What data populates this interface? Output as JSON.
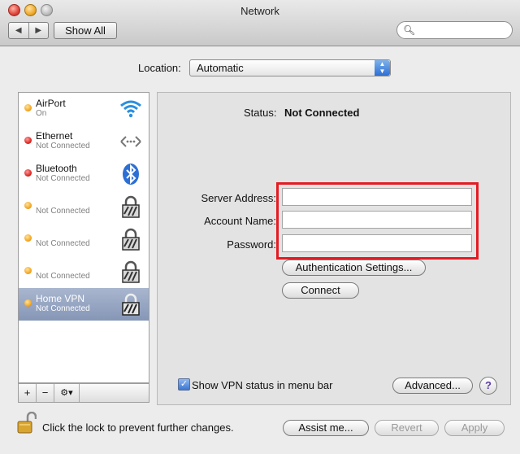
{
  "window": {
    "title": "Network"
  },
  "toolbar": {
    "back": "◀",
    "forward": "▶",
    "show_all": "Show All",
    "search_placeholder": ""
  },
  "location": {
    "label": "Location:",
    "value": "Automatic"
  },
  "sidebar": {
    "items": [
      {
        "name": "AirPort",
        "status": "On",
        "dot": "orange",
        "icon": "wifi-icon"
      },
      {
        "name": "Ethernet",
        "status": "Not Connected",
        "dot": "red",
        "icon": "ethernet-icon"
      },
      {
        "name": "Bluetooth",
        "status": "Not Connected",
        "dot": "red",
        "icon": "bluetooth-icon"
      },
      {
        "name": "",
        "status": "Not Connected",
        "dot": "orange",
        "icon": "vpn-lock-icon"
      },
      {
        "name": "",
        "status": "Not Connected",
        "dot": "orange",
        "icon": "vpn-lock-icon"
      },
      {
        "name": "",
        "status": "Not Connected",
        "dot": "orange",
        "icon": "vpn-lock-icon"
      },
      {
        "name": "Home VPN",
        "status": "Not Connected",
        "dot": "orange",
        "icon": "vpn-lock-icon",
        "selected": true
      }
    ],
    "add": "+",
    "remove": "−",
    "action": "⚙▾"
  },
  "detail": {
    "status_label": "Status:",
    "status_value": "Not Connected",
    "server_address_label": "Server Address:",
    "server_address_value": "",
    "account_name_label": "Account Name:",
    "account_name_value": "",
    "password_label": "Password:",
    "password_value": "",
    "auth_settings": "Authentication Settings...",
    "connect": "Connect",
    "show_vpn_status": "Show VPN status in menu bar",
    "show_vpn_checked": true,
    "advanced": "Advanced...",
    "help": "?"
  },
  "footer": {
    "lock_text": "Click the lock to prevent further changes.",
    "assist": "Assist me...",
    "revert": "Revert",
    "apply": "Apply"
  },
  "colors": {
    "highlight": "#e41b23",
    "selection": "#8596b6",
    "accent": "#2d6fd4"
  }
}
